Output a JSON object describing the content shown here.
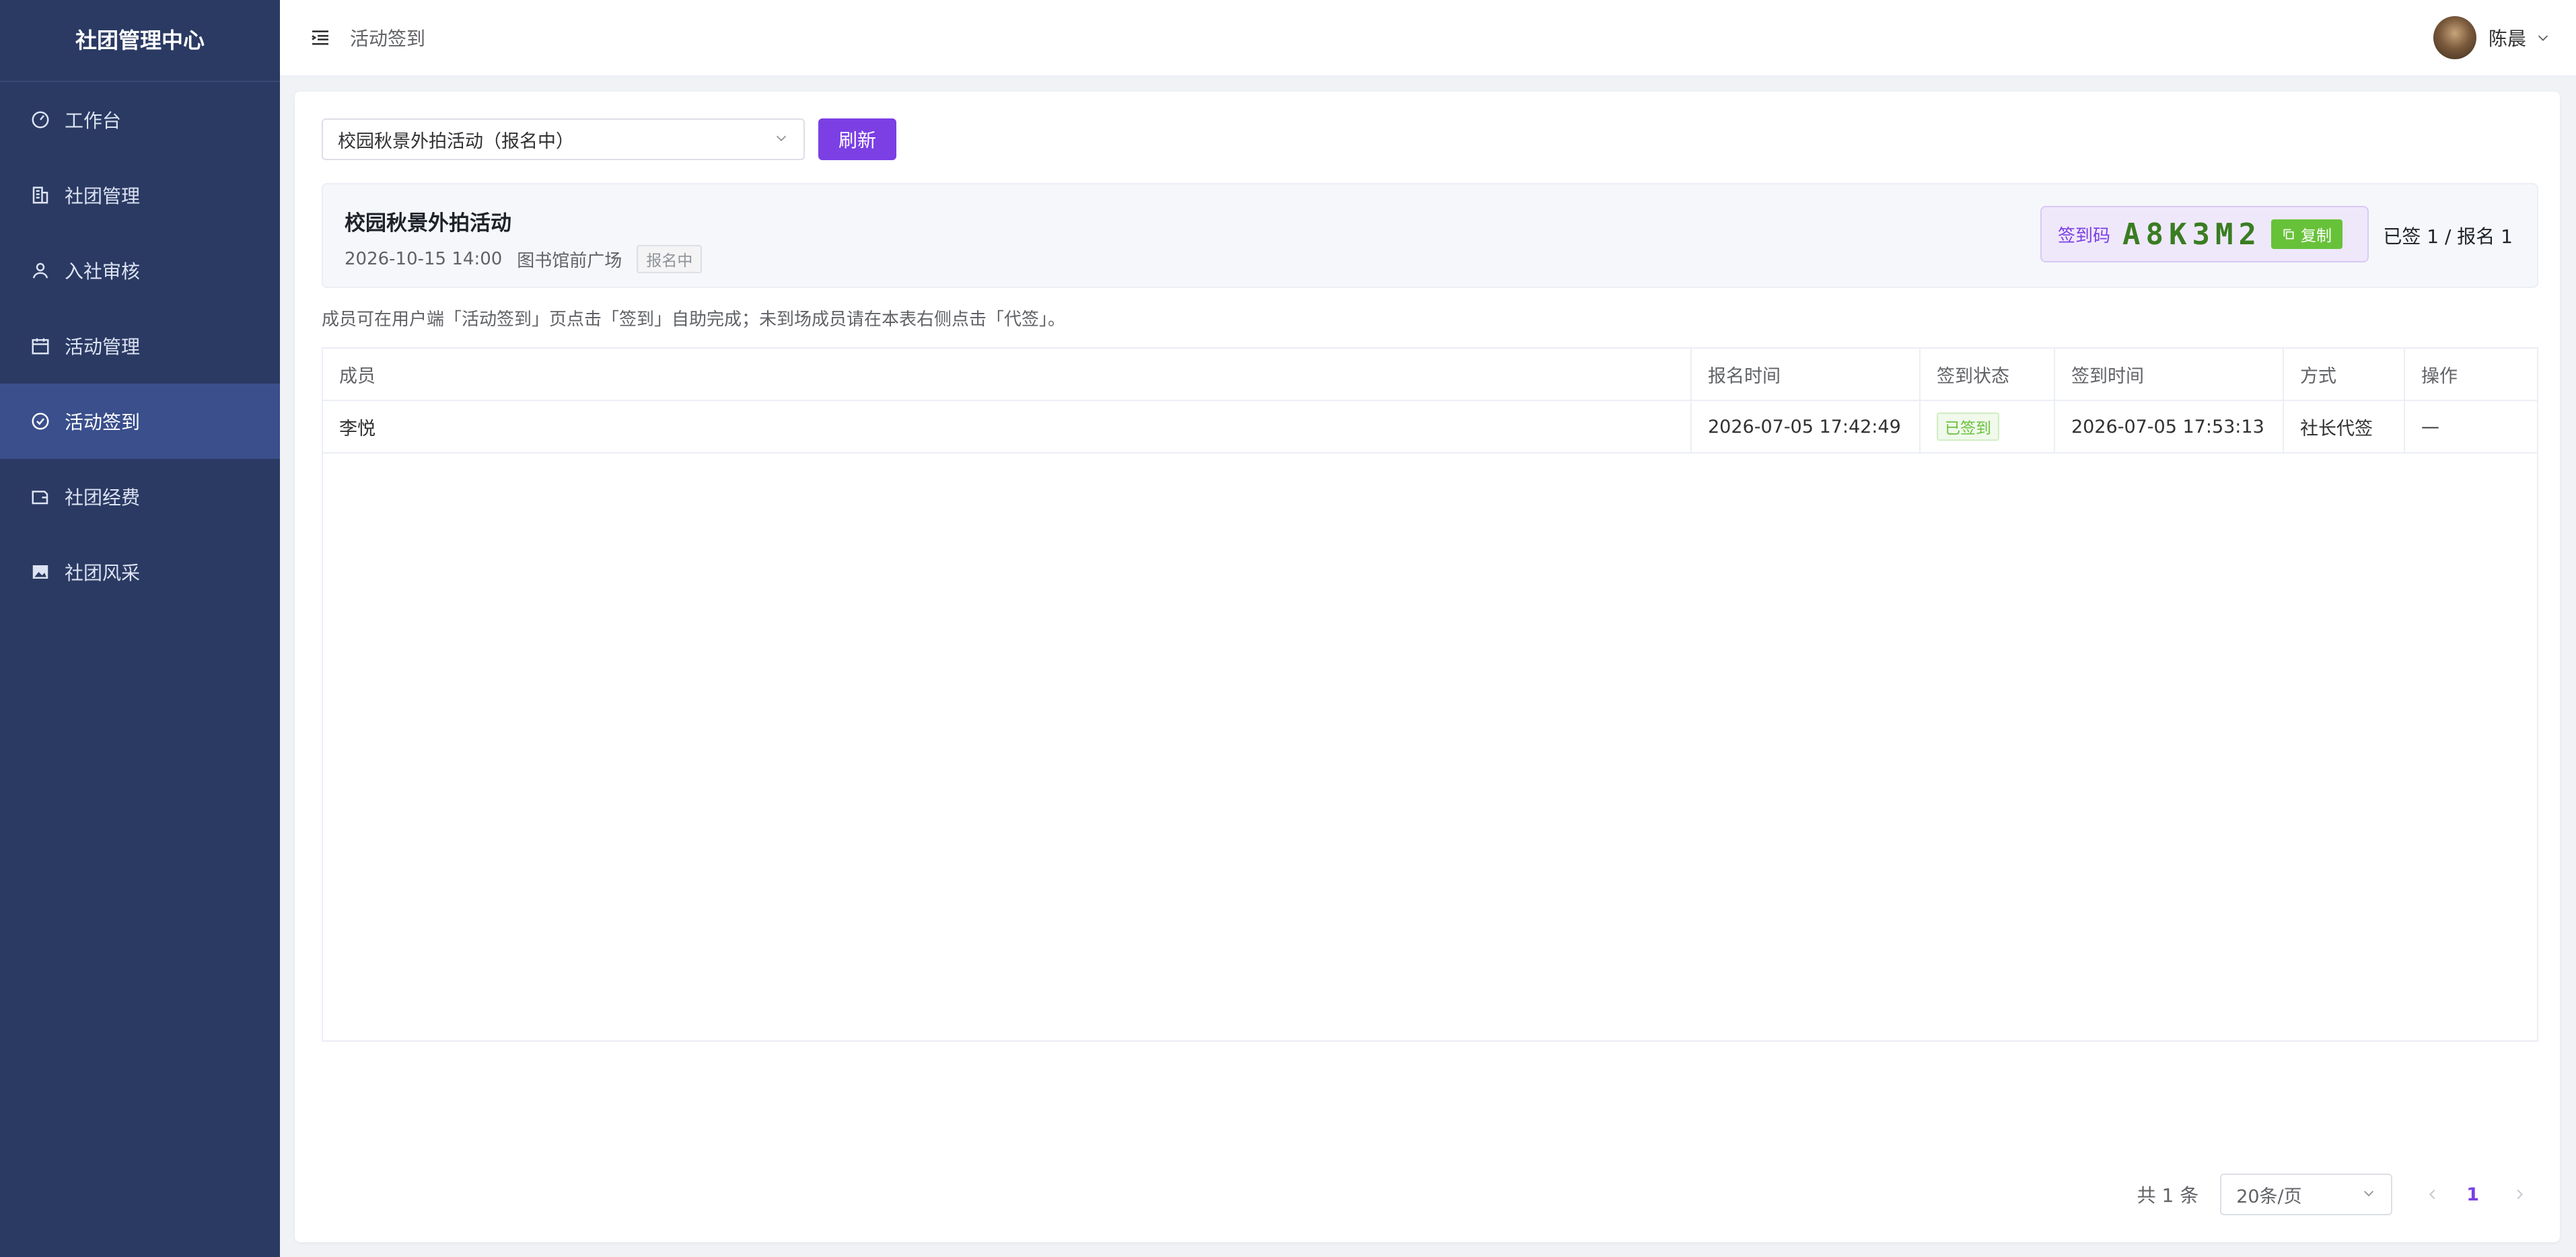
{
  "sidebar": {
    "brand": "社团管理中心",
    "items": [
      {
        "label": "工作台",
        "icon": "dashboard-icon"
      },
      {
        "label": "社团管理",
        "icon": "building-icon"
      },
      {
        "label": "入社审核",
        "icon": "user-icon"
      },
      {
        "label": "活动管理",
        "icon": "calendar-icon"
      },
      {
        "label": "活动签到",
        "icon": "check-circle-icon",
        "active": true
      },
      {
        "label": "社团经费",
        "icon": "wallet-icon"
      },
      {
        "label": "社团风采",
        "icon": "image-icon"
      }
    ]
  },
  "header": {
    "breadcrumb": "活动签到",
    "username": "陈晨"
  },
  "toolbar": {
    "activity_select": "校园秋景外拍活动（报名中）",
    "refresh_label": "刷新"
  },
  "activity": {
    "title": "校园秋景外拍活动",
    "datetime": "2026-10-15 14:00",
    "location": "图书馆前广场",
    "status": "报名中",
    "code_label": "签到码",
    "code": "A8K3M2",
    "copy_label": "复制",
    "count_text": "已签 1 / 报名 1"
  },
  "hint": "成员可在用户端「活动签到」页点击「签到」自助完成；未到场成员请在本表右侧点击「代签」。",
  "table": {
    "headers": [
      "成员",
      "报名时间",
      "签到状态",
      "签到时间",
      "方式",
      "操作"
    ],
    "rows": [
      {
        "member": "李悦",
        "signup_time": "2026-07-05 17:42:49",
        "status": "已签到",
        "checkin_time": "2026-07-05 17:53:13",
        "method": "社长代签",
        "action": "—"
      }
    ]
  },
  "pagination": {
    "total": "共 1 条",
    "page_size": "20条/页",
    "current_page": "1"
  },
  "colors": {
    "sidebar_bg": "#2b3a63",
    "sidebar_active": "#3a4f8c",
    "primary": "#7b3fe4",
    "success": "#67c23a",
    "code_text": "#3a7d22"
  }
}
